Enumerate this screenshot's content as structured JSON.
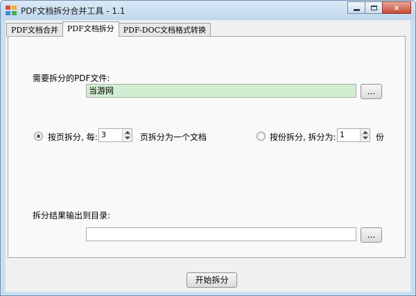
{
  "window": {
    "title": "PDF文档拆分合并工具 - 1.1",
    "min_label": "minimize",
    "max_label": "maximize",
    "close_label": "×"
  },
  "tabs": [
    {
      "label": "PDF文档合并",
      "active": false
    },
    {
      "label": "PDF文档拆分",
      "active": true
    },
    {
      "label": "PDF-DOC文档格式转换",
      "active": false
    }
  ],
  "split": {
    "source_label": "需要拆分的PDF文件:",
    "source_value": "当游网",
    "browse_label": "...",
    "by_page_label": "按页拆分, 每:",
    "by_page_value": "3",
    "by_page_suffix": "页拆分为一个文档",
    "by_copies_label": "按份拆分, 拆分为:",
    "by_copies_value": "1",
    "by_copies_suffix": "份",
    "output_label": "拆分结果输出到目录:",
    "output_value": "",
    "output_browse_label": "...",
    "selected_mode": "by_page"
  },
  "action": {
    "start_label": "开始拆分"
  }
}
